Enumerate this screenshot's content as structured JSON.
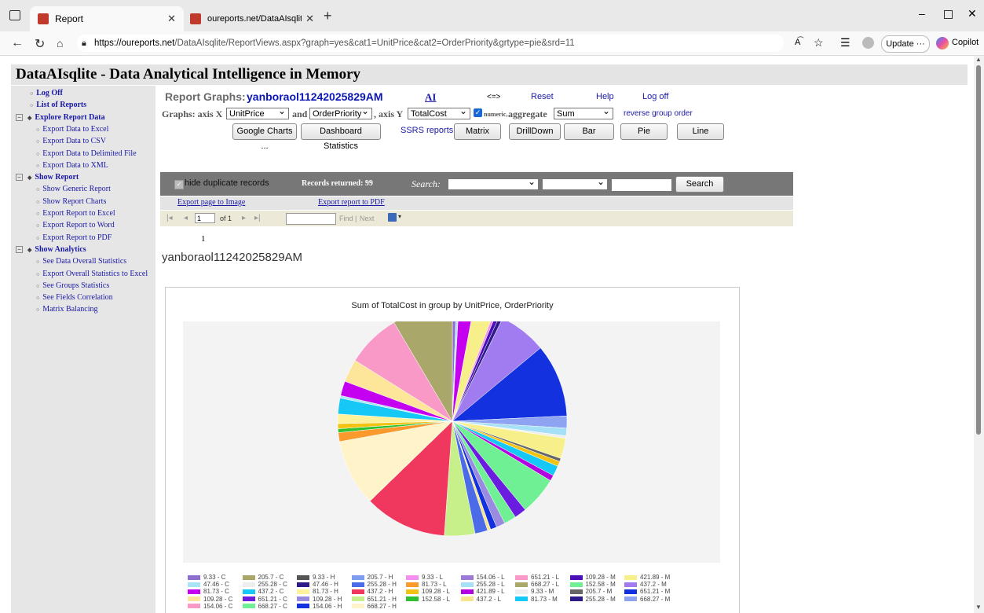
{
  "browser": {
    "tabs": [
      {
        "title": "Report",
        "active": true
      },
      {
        "title": "oureports.net/DataAIsqlite/DataA",
        "active": false
      }
    ],
    "url_host": "https://oureports.net",
    "url_path": "/DataAIsqlite/ReportViews.aspx?graph=yes&cat1=UnitPrice&cat2=OrderPriority&grtype=pie&srd=11",
    "update_label": "Update",
    "copilot_label": "Copilot"
  },
  "banner": {
    "title": "DataAIsqlite - Data Analytical Intelligence in Memory"
  },
  "sidebar": {
    "items": [
      {
        "label": "Log Off",
        "bold": true,
        "type": "bullet"
      },
      {
        "label": "List of Reports",
        "bold": true,
        "type": "bullet"
      },
      {
        "label": "Explore Report Data",
        "bold": true,
        "type": "section"
      },
      {
        "label": "Export Data to Excel",
        "type": "sub"
      },
      {
        "label": "Export Data to CSV",
        "type": "sub"
      },
      {
        "label": "Export Data to Delimited File",
        "type": "sub"
      },
      {
        "label": "Export Data to XML",
        "type": "sub"
      },
      {
        "label": "Show Report",
        "bold": true,
        "type": "section"
      },
      {
        "label": "Show Generic Report",
        "type": "sub"
      },
      {
        "label": "Show Report Charts",
        "type": "sub"
      },
      {
        "label": "Export Report to Excel",
        "type": "sub"
      },
      {
        "label": "Export Report to Word",
        "type": "sub"
      },
      {
        "label": "Export Report to PDF",
        "type": "sub"
      },
      {
        "label": "Show Analytics",
        "bold": true,
        "type": "section"
      },
      {
        "label": "See Data Overall Statistics",
        "type": "sub"
      },
      {
        "label": "Export Overall Statistics to Excel",
        "type": "sub"
      },
      {
        "label": "See Groups Statistics",
        "type": "sub"
      },
      {
        "label": "See Fields Correlation",
        "type": "sub"
      },
      {
        "label": "Matrix Balancing",
        "type": "sub"
      }
    ]
  },
  "header": {
    "report_graphs_label": "Report Graphs:",
    "report_name": "yanboraol11242025829AM",
    "ai_label": "AI",
    "swap_label": "<=>",
    "reset_label": "Reset",
    "help_label": "Help",
    "logoff_label": "Log off"
  },
  "controls": {
    "graphs_label": "Graphs: axis X",
    "axis_x": "UnitPrice",
    "and_label": "and",
    "second_cat": "OrderPriority",
    "axis_y_label": ", axis Y",
    "axis_y": "TotalCost",
    "numeric_label": "numeric,",
    "aggregate_label": "aggregate",
    "aggregate": "Sum",
    "reverse_label": "reverse group order",
    "google_charts": "Google Charts ...",
    "dashboard": "Dashboard Statistics",
    "ssrs_label": "SSRS reports:",
    "matrix": "Matrix",
    "drilldown": "DrillDown",
    "bar": "Bar",
    "pie": "Pie",
    "line": "Line"
  },
  "filterbar": {
    "hide_dup": "hide duplicate records",
    "records": "Records returned: 99",
    "search_label": "Search:",
    "search_button": "Search"
  },
  "exports": {
    "image": "Export page to Image",
    "pdf": "Export report to PDF"
  },
  "reportviewer": {
    "page": "1",
    "of": "of 1",
    "find": "Find",
    "sep": "|",
    "next": "Next"
  },
  "report": {
    "page_marker": "1",
    "title": "yanboraol11242025829AM"
  },
  "chart_data": {
    "type": "pie",
    "title": "Sum of TotalCost in group by UnitPrice, OrderPriority",
    "legend_position": "bottom",
    "slices": [
      {
        "label": "9.33 - C",
        "value": 0.6,
        "color": "#8e6fcf"
      },
      {
        "label": "205.7 - C",
        "value": 9.5,
        "color": "#a9a86a"
      },
      {
        "label": "9.33 - H",
        "value": 0.4,
        "color": "#555555"
      },
      {
        "label": "205.7 - H",
        "value": 0.5,
        "color": "#7d9ef0"
      },
      {
        "label": "9.33 - L",
        "value": 0.4,
        "color": "#f48ff0"
      },
      {
        "label": "154.06 - L",
        "value": 0.5,
        "color": "#9d7ad6"
      },
      {
        "label": "651.21 - L",
        "value": 8.5,
        "color": "#f899c8"
      },
      {
        "label": "109.28 - M",
        "value": 0.6,
        "color": "#4a0fb8"
      },
      {
        "label": "421.89 - M",
        "value": 3.2,
        "color": "#f7f08a"
      },
      {
        "label": "47.46 - C",
        "value": 0.4,
        "color": "#a8e4f5"
      },
      {
        "label": "255.28 - C",
        "value": 0.4,
        "color": "#eeeeee"
      },
      {
        "label": "47.46 - H",
        "value": 0.5,
        "color": "#2e1a88"
      },
      {
        "label": "255.28 - H",
        "value": 2.0,
        "color": "#4c6be8"
      },
      {
        "label": "81.73 - L",
        "value": 1.4,
        "color": "#fb9a2c"
      },
      {
        "label": "255.28 - L",
        "value": 1.2,
        "color": "#a6e0f6"
      },
      {
        "label": "668.27 - L",
        "value": 0.5,
        "color": "#a9a86a"
      },
      {
        "label": "152.58 - M",
        "value": 6.0,
        "color": "#70f095"
      },
      {
        "label": "437.2 - M",
        "value": 7.5,
        "color": "#a07cf0"
      },
      {
        "label": "81.73 - C",
        "value": 2.3,
        "color": "#c500f0"
      },
      {
        "label": "437.2 - C",
        "value": 2.5,
        "color": "#16c8f5"
      },
      {
        "label": "81.73 - H",
        "value": 1.5,
        "color": "#fff29a"
      },
      {
        "label": "437.2 - H",
        "value": 13.0,
        "color": "#f0385f"
      },
      {
        "label": "109.28 - L",
        "value": 0.8,
        "color": "#f2c313"
      },
      {
        "label": "421.89 - L",
        "value": 0.9,
        "color": "#b200e0"
      },
      {
        "label": "9.33 - M",
        "value": 0.4,
        "color": "#eeeeee"
      },
      {
        "label": "205.7 - M",
        "value": 0.5,
        "color": "#666666"
      },
      {
        "label": "651.21 - M",
        "value": 11.5,
        "color": "#1431e0"
      },
      {
        "label": "109.28 - C",
        "value": 3.6,
        "color": "#fde59a"
      },
      {
        "label": "651.21 - C",
        "value": 1.9,
        "color": "#6a1de0"
      },
      {
        "label": "109.28 - H",
        "value": 1.4,
        "color": "#9a8ae0"
      },
      {
        "label": "651.21 - H",
        "value": 4.8,
        "color": "#c8f08a"
      },
      {
        "label": "152.58 - L",
        "value": 0.6,
        "color": "#2fc12f"
      },
      {
        "label": "437.2 - L",
        "value": 0.5,
        "color": "#f7e78c"
      },
      {
        "label": "81.73 - M",
        "value": 1.6,
        "color": "#16c8f5"
      },
      {
        "label": "255.28 - M",
        "value": 0.6,
        "color": "#2e1a88"
      },
      {
        "label": "668.27 - M",
        "value": 1.9,
        "color": "#8ea4f2"
      },
      {
        "label": "154.06 - C",
        "value": 0.7,
        "color": "#f899c8"
      },
      {
        "label": "668.27 - C",
        "value": 1.9,
        "color": "#70f095"
      },
      {
        "label": "154.06 - H",
        "value": 1.0,
        "color": "#1431e0"
      },
      {
        "label": "668.27 - H",
        "value": 10.5,
        "color": "#fff4c9"
      }
    ],
    "pie_order": [
      "9.33 - C",
      "47.46 - C",
      "81.73 - C",
      "421.89 - M",
      "9.33 - L",
      "109.28 - M",
      "255.28 - M",
      "437.2 - M",
      "651.21 - M",
      "668.27 - M",
      "255.28 - L",
      "9.33 - M",
      "421.89 - M",
      "205.7 - M",
      "109.28 - L",
      "81.73 - M",
      "421.89 - L",
      "152.58 - M",
      "651.21 - C",
      "668.27 - C",
      "109.28 - H",
      "154.06 - H",
      "437.2 - L",
      "255.28 - H",
      "651.21 - H",
      "437.2 - H",
      "668.27 - H",
      "81.73 - L",
      "152.58 - L",
      "109.28 - L",
      "81.73 - H",
      "437.2 - C",
      "47.46 - C",
      "81.73 - C",
      "109.28 - C",
      "651.21 - L",
      "205.7 - C"
    ]
  }
}
